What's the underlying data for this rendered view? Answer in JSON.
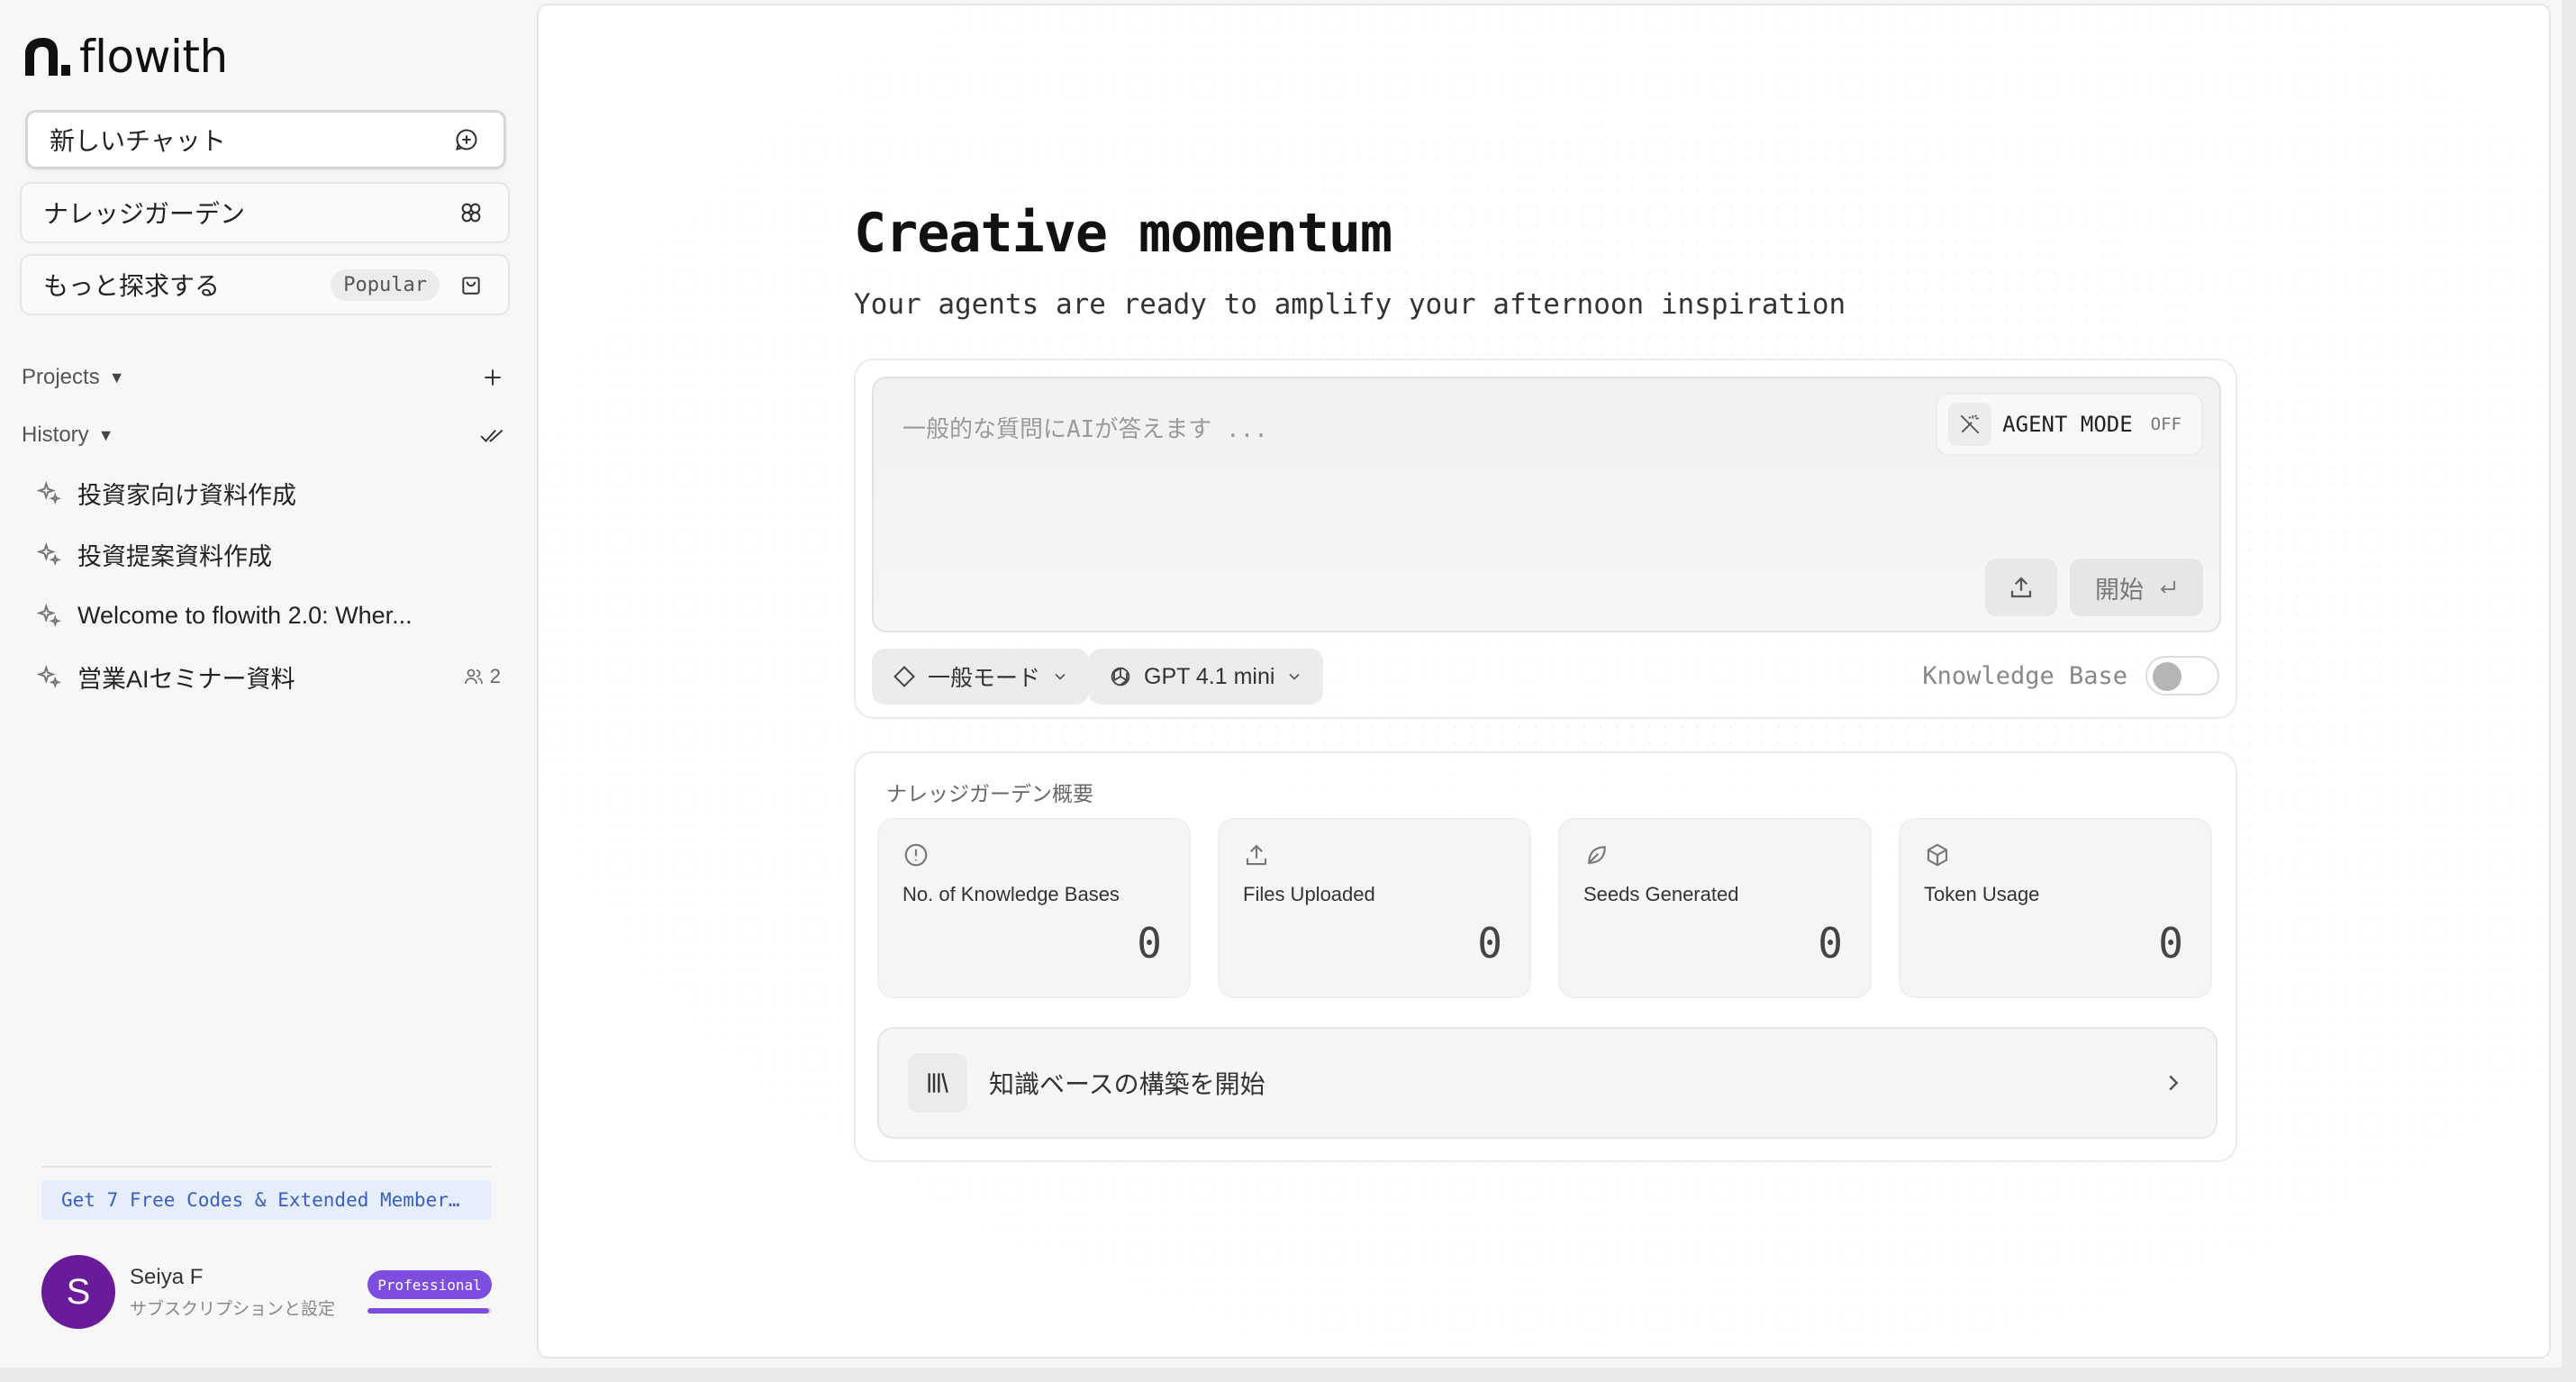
{
  "brand": {
    "name": "flowith"
  },
  "sidebar": {
    "new_chat": "新しいチャット",
    "knowledge_garden": "ナレッジガーデン",
    "explore": "もっと探求する",
    "explore_badge": "Popular",
    "projects_label": "Projects",
    "history_label": "History",
    "history": [
      {
        "title": "投資家向け資料作成"
      },
      {
        "title": "投資提案資料作成"
      },
      {
        "title": "Welcome to flowith 2.0: Wher..."
      },
      {
        "title": "営業AIセミナー資料",
        "shared_count": "2"
      }
    ],
    "promo": "Get 7 Free Codes & Extended Member…",
    "user": {
      "initial": "S",
      "name": "Seiya F",
      "subtitle": "サブスクリプションと設定",
      "plan": "Professional",
      "plan_progress": 0.98
    }
  },
  "main": {
    "title": "Creative momentum",
    "subtitle": "Your agents are ready to amplify your afternoon inspiration",
    "composer": {
      "placeholder": "一般的な質問にAIが答えます ...",
      "agent_mode_label": "AGENT MODE",
      "agent_mode_state": "OFF",
      "start_label": "開始",
      "mode_select": "一般モード",
      "model_select": "GPT 4.1 mini",
      "knowledge_base_label": "Knowledge Base",
      "knowledge_base_enabled": false
    },
    "overview": {
      "title": "ナレッジガーデン概要",
      "stats": [
        {
          "label": "No. of Knowledge Bases",
          "value": "0",
          "icon": "info-circle-icon"
        },
        {
          "label": "Files Uploaded",
          "value": "0",
          "icon": "upload-icon"
        },
        {
          "label": "Seeds Generated",
          "value": "0",
          "icon": "seed-icon"
        },
        {
          "label": "Token Usage",
          "value": "0",
          "icon": "cube-icon"
        }
      ],
      "start_kb_label": "知識ベースの構築を開始"
    }
  },
  "colors": {
    "accent": "#7c4dde",
    "avatar": "#6a1b9a",
    "promo_text": "#3a5ec9",
    "promo_bg": "#e6edfb"
  }
}
